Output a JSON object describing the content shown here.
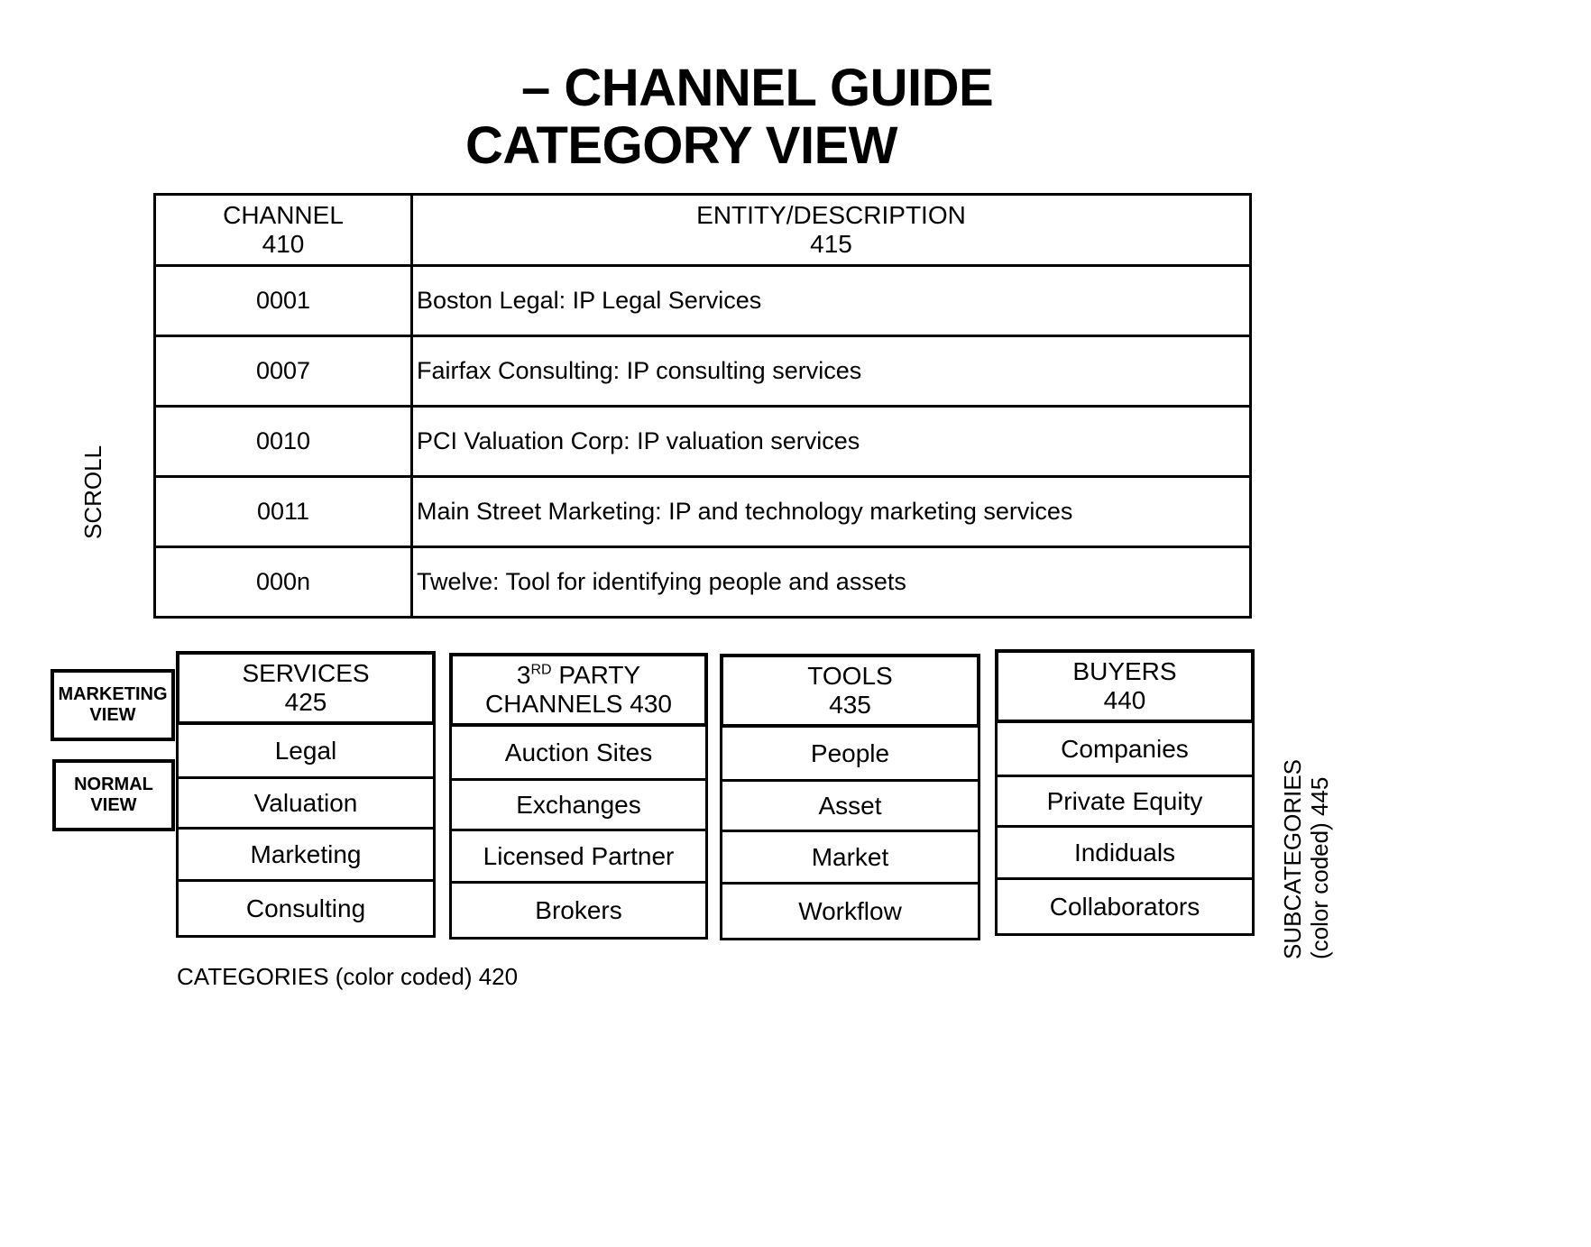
{
  "title": {
    "line1": "– CHANNEL GUIDE",
    "line2": "CATEGORY VIEW"
  },
  "table": {
    "headers": [
      {
        "label": "CHANNEL",
        "ref": "410"
      },
      {
        "label": "ENTITY/DESCRIPTION",
        "ref": "415"
      }
    ],
    "rows": [
      {
        "channel": "0001",
        "description": "Boston Legal: IP Legal Services"
      },
      {
        "channel": "0007",
        "description": "Fairfax Consulting: IP consulting services"
      },
      {
        "channel": "0010",
        "description": "PCI Valuation Corp: IP valuation services"
      },
      {
        "channel": "0011",
        "description": "Main Street Marketing: IP and technology marketing services"
      },
      {
        "channel": "000n",
        "description": "Twelve: Tool for identifying people and assets"
      }
    ]
  },
  "scroll_label": "SCROLL",
  "view_buttons": {
    "marketing": {
      "line1": "MARKETING",
      "line2": "VIEW"
    },
    "normal": {
      "line1": "NORMAL",
      "line2": "VIEW"
    }
  },
  "categories": [
    {
      "line1": "SERVICES",
      "line2": "425",
      "subcategories": [
        "Legal",
        "Valuation",
        "Marketing",
        "Consulting"
      ]
    },
    {
      "line1_prefix": "3",
      "line1_sup": "RD",
      "line1_suffix": " PARTY",
      "line2": "CHANNELS 430",
      "subcategories": [
        "Auction Sites",
        "Exchanges",
        "Licensed Partner",
        "Brokers"
      ]
    },
    {
      "line1": "TOOLS",
      "line2": "435",
      "subcategories": [
        "People",
        "Asset",
        "Market",
        "Workflow"
      ]
    },
    {
      "line1": "BUYERS",
      "line2": "440",
      "subcategories": [
        "Companies",
        "Private Equity",
        "Indiduals",
        "Collaborators"
      ]
    }
  ],
  "categories_label": "CATEGORIES (color coded) 420",
  "subcategories_label": {
    "line1": "SUBCATEGORIES",
    "line2": "(color coded) 445"
  }
}
